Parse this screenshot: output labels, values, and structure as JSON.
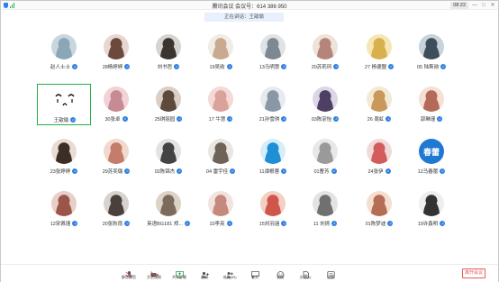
{
  "titlebar": {
    "title": "腾讯会议 会议号：614 386 950",
    "clock": "08:22",
    "minimize": "—",
    "maximize": "□",
    "close": "✕"
  },
  "speaker_banner": "正在讲话：王歆瑜",
  "participants": [
    {
      "name": "赵人士士",
      "avatar": "photo"
    },
    {
      "name": "28杨婷婷",
      "avatar": "photo"
    },
    {
      "name": "刘书哲",
      "avatar": "photo"
    },
    {
      "name": "19吴勋",
      "avatar": "photo"
    },
    {
      "name": "13马明慧",
      "avatar": "photo"
    },
    {
      "name": "20苏莉珂",
      "avatar": "photo"
    },
    {
      "name": "27 杨德盟",
      "avatar": "photo"
    },
    {
      "name": "05 陆斯勋",
      "avatar": "photo"
    },
    {
      "name": "王歆瑜",
      "avatar": "drawing",
      "active": true
    },
    {
      "name": "30张卓",
      "avatar": "photo"
    },
    {
      "name": "25琪丽园",
      "avatar": "photo"
    },
    {
      "name": "17 牛慧",
      "avatar": "photo"
    },
    {
      "name": "21孙雪琪",
      "avatar": "photo"
    },
    {
      "name": "03陈宓怡",
      "avatar": "photo"
    },
    {
      "name": "26 周虹",
      "avatar": "photo"
    },
    {
      "name": "郭琳瑾",
      "avatar": "photo"
    },
    {
      "name": "23张婷婷",
      "avatar": "photo"
    },
    {
      "name": "29苏奕璐",
      "avatar": "photo"
    },
    {
      "name": "02陈锦杰",
      "avatar": "photo"
    },
    {
      "name": "04 雷宇佳",
      "avatar": "photo"
    },
    {
      "name": "11谭根蓉",
      "avatar": "photo"
    },
    {
      "name": "01曹芳",
      "avatar": "photo"
    },
    {
      "name": "24张伊",
      "avatar": "photo"
    },
    {
      "name": "12马春蕾",
      "avatar": "text",
      "text": "春蕾"
    },
    {
      "name": "12宋佩瑾",
      "avatar": "photo"
    },
    {
      "name": "20张秋雨",
      "avatar": "photo"
    },
    {
      "name": "英语BG181 郑...",
      "avatar": "photo"
    },
    {
      "name": "10李亮",
      "avatar": "photo"
    },
    {
      "name": "15刘羽涵",
      "avatar": "photo"
    },
    {
      "name": "11 刘倩",
      "avatar": "photo"
    },
    {
      "name": "01陈梦迪",
      "avatar": "photo"
    },
    {
      "name": "19许鑫明",
      "avatar": "photo"
    }
  ],
  "toolbar": {
    "items": [
      {
        "label": "解除静音",
        "icon": "mic-muted-icon"
      },
      {
        "label": "开启视频",
        "icon": "camera-off-icon"
      },
      {
        "label": "共享屏幕",
        "icon": "share-screen-icon"
      },
      {
        "label": "邀请",
        "icon": "invite-icon"
      },
      {
        "label": "成员(39)",
        "icon": "members-icon"
      },
      {
        "label": "聊天",
        "icon": "chat-icon"
      },
      {
        "label": "表情",
        "icon": "emoji-icon"
      },
      {
        "label": "文档(1)",
        "icon": "document-icon"
      },
      {
        "label": "设置",
        "icon": "settings-icon"
      }
    ],
    "leave": "离开会议"
  },
  "colors": {
    "accent": "#2f7fe0",
    "active_border": "#22b14c",
    "leave": "#e35a5a"
  }
}
